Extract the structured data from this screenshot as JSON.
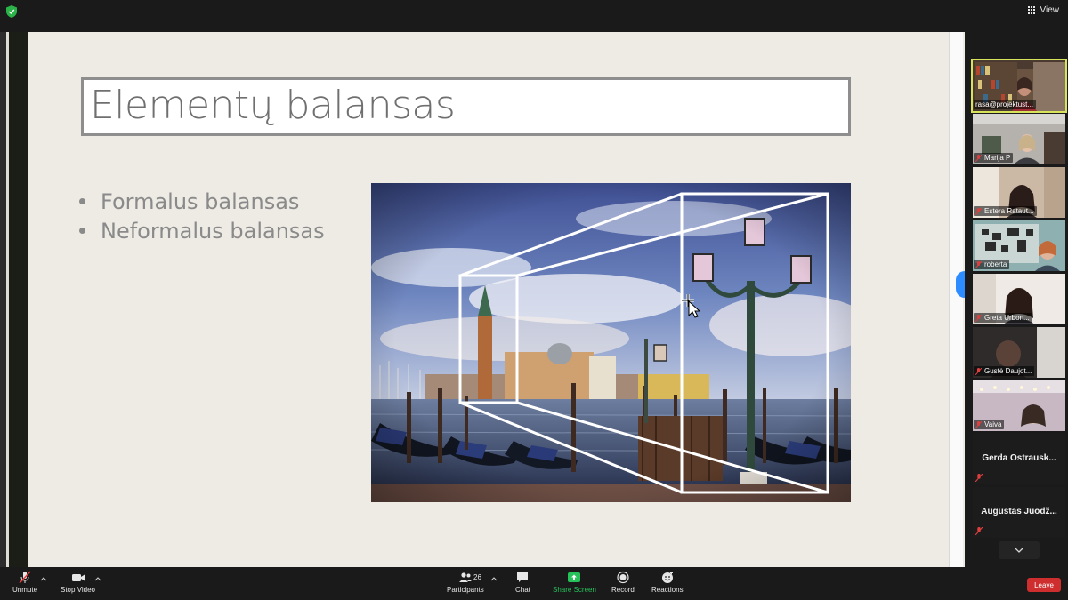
{
  "topbar": {
    "security_icon": "shield-check-icon",
    "view_label": "View",
    "view_icon": "grid-view-icon",
    "colors": {
      "shield": "#2bb34a",
      "background": "#1a1a1a"
    }
  },
  "slide": {
    "title": "Elementų balansas",
    "bullets": [
      "Formalus balansas",
      "Neformalus balansas"
    ],
    "image": "venice-gondolas-with-perspective-frame",
    "colors": {
      "background": "#eeebe5",
      "text": "#6f6f6f"
    }
  },
  "participants": [
    {
      "name": "rasa@projektust...",
      "video": true,
      "active": true,
      "muted": false
    },
    {
      "name": "Marija P",
      "video": true,
      "muted": true
    },
    {
      "name": "Estera Rataut...",
      "video": true,
      "muted": true
    },
    {
      "name": "roberta",
      "video": true,
      "muted": true
    },
    {
      "name": "Greta Urbon...",
      "video": true,
      "muted": true
    },
    {
      "name": "Gustė Daujot...",
      "video": true,
      "muted": true
    },
    {
      "name": "Vaiva",
      "video": true,
      "muted": true
    },
    {
      "name": "Gerda  Ostrausk...",
      "video": false,
      "muted": true
    },
    {
      "name": "Augustas  Juodž...",
      "video": false,
      "muted": true
    }
  ],
  "participant_panel": {
    "scroll_icon": "chevron-down-icon"
  },
  "toolbar": {
    "unmute_label": "Unmute",
    "stop_video_label": "Stop Video",
    "participants_label": "Participants",
    "participants_count": "26",
    "chat_label": "Chat",
    "share_screen_label": "Share Screen",
    "record_label": "Record",
    "reactions_label": "Reactions",
    "leave_label": "Leave",
    "colors": {
      "share": "#26c25a",
      "leave": "#cf2e2e",
      "muted": "#e03e3e"
    }
  }
}
